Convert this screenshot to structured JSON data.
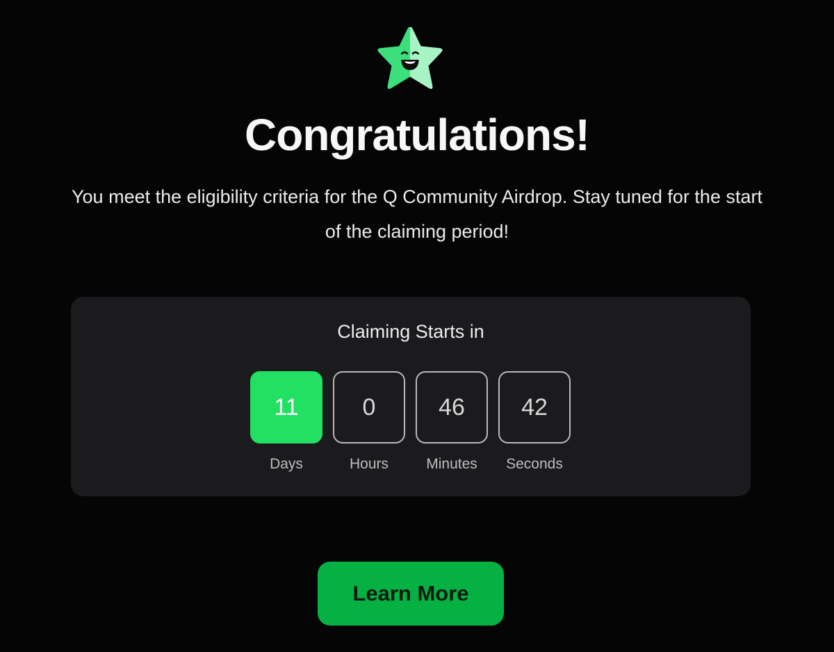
{
  "hero": {
    "icon": "smiling-star-icon",
    "title": "Congratulations!",
    "message": "You meet the eligibility criteria for the Q Community Airdrop. Stay tuned for the start of the claiming period!"
  },
  "countdown": {
    "title": "Claiming Starts in",
    "units": [
      {
        "value": "11",
        "label": "Days"
      },
      {
        "value": "0",
        "label": "Hours"
      },
      {
        "value": "46",
        "label": "Minutes"
      },
      {
        "value": "42",
        "label": "Seconds"
      }
    ]
  },
  "actions": {
    "learn_more_label": "Learn More"
  },
  "colors": {
    "background": "#050505",
    "panel": "#1b1b1e",
    "accent_green": "#21e062",
    "button_green": "#06b144",
    "star_dark": "#3be07c",
    "star_light": "#a8f3c4"
  }
}
